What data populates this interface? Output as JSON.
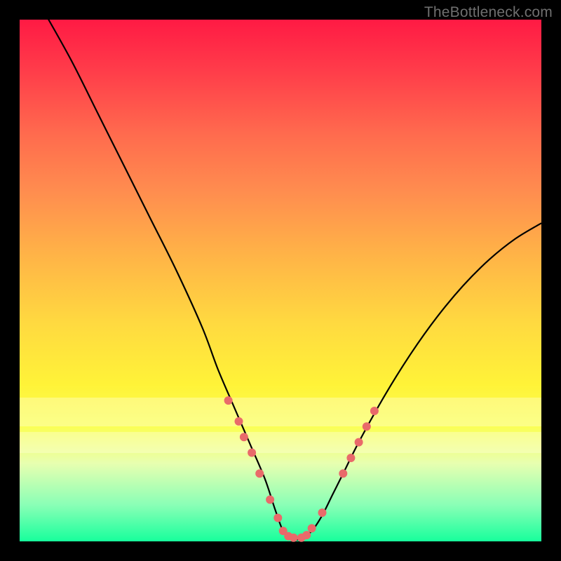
{
  "watermark": "TheBottleneck.com",
  "chart_data": {
    "type": "line",
    "title": "",
    "xlabel": "",
    "ylabel": "",
    "xlim": [
      0,
      100
    ],
    "ylim": [
      0,
      100
    ],
    "curve": {
      "name": "bottleneck-curve",
      "color": "#000000",
      "x": [
        0,
        5,
        10,
        15,
        20,
        25,
        30,
        35,
        38,
        41,
        44,
        47,
        49,
        50.5,
        52,
        54,
        56,
        58,
        60,
        62,
        65,
        70,
        75,
        80,
        85,
        90,
        95,
        100
      ],
      "y": [
        110,
        101,
        92,
        82,
        72,
        62,
        52,
        41,
        33,
        26,
        19,
        12,
        6,
        2,
        0.5,
        0.5,
        2,
        5,
        9,
        13,
        19,
        28,
        36,
        43,
        49,
        54,
        58,
        61
      ]
    },
    "markers": {
      "name": "highlight-points",
      "color": "#e96a6a",
      "radius": 6,
      "points": [
        {
          "x": 40,
          "y": 27
        },
        {
          "x": 42,
          "y": 23
        },
        {
          "x": 43,
          "y": 20
        },
        {
          "x": 44.5,
          "y": 17
        },
        {
          "x": 46,
          "y": 13
        },
        {
          "x": 48,
          "y": 8
        },
        {
          "x": 49.5,
          "y": 4.5
        },
        {
          "x": 50.5,
          "y": 2
        },
        {
          "x": 51.5,
          "y": 1
        },
        {
          "x": 52.5,
          "y": 0.7
        },
        {
          "x": 54,
          "y": 0.7
        },
        {
          "x": 55,
          "y": 1.2
        },
        {
          "x": 56,
          "y": 2.5
        },
        {
          "x": 58,
          "y": 5.5
        },
        {
          "x": 62,
          "y": 13
        },
        {
          "x": 63.5,
          "y": 16
        },
        {
          "x": 65,
          "y": 19
        },
        {
          "x": 66.5,
          "y": 22
        },
        {
          "x": 68,
          "y": 25
        }
      ]
    },
    "bands": [
      {
        "top_pct": 72.5,
        "height_pct": 5.5
      },
      {
        "top_pct": 79.0,
        "height_pct": 4.0
      }
    ]
  }
}
